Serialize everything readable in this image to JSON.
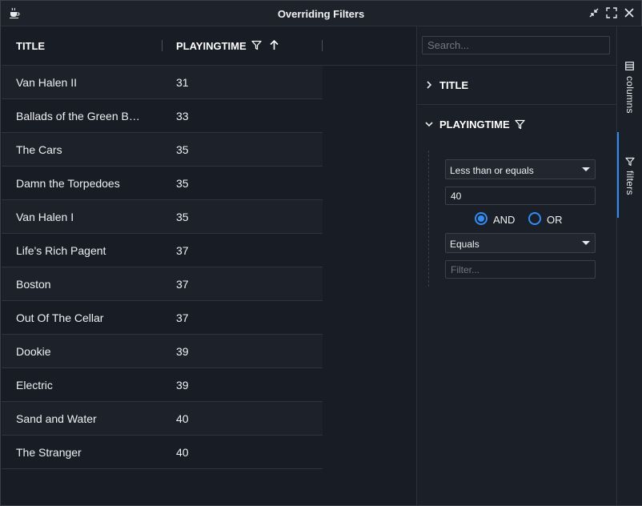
{
  "window": {
    "title": "Overriding Filters",
    "icon": "coffee-cup-icon",
    "controls": [
      "collapse-icon",
      "maximize-icon",
      "close-icon"
    ]
  },
  "grid": {
    "columns": [
      {
        "label": "TITLE"
      },
      {
        "label": "PLAYINGTIME",
        "icons": [
          "filter-icon",
          "sort-ascending-icon"
        ]
      }
    ],
    "rows": [
      {
        "title": "Van Halen II",
        "playingtime": "31"
      },
      {
        "title": "Ballads of the Green Ber...",
        "playingtime": "33"
      },
      {
        "title": "The Cars",
        "playingtime": "35"
      },
      {
        "title": "Damn the Torpedoes",
        "playingtime": "35"
      },
      {
        "title": "Van Halen I",
        "playingtime": "35"
      },
      {
        "title": "Life's Rich Pagent",
        "playingtime": "37"
      },
      {
        "title": "Boston",
        "playingtime": "37"
      },
      {
        "title": "Out Of The Cellar",
        "playingtime": "37"
      },
      {
        "title": "Dookie",
        "playingtime": "39"
      },
      {
        "title": "Electric",
        "playingtime": "39"
      },
      {
        "title": "Sand and Water",
        "playingtime": "40"
      },
      {
        "title": "The Stranger",
        "playingtime": "40"
      }
    ]
  },
  "filter_panel": {
    "search_placeholder": "Search...",
    "sections": [
      {
        "label": "TITLE",
        "expanded": false
      },
      {
        "label": "PLAYINGTIME",
        "expanded": true,
        "filtered": true
      }
    ],
    "condition1": {
      "operator": "Less than or equals",
      "value": "40"
    },
    "join": {
      "options": [
        "AND",
        "OR"
      ],
      "selected": "AND"
    },
    "condition2": {
      "operator": "Equals",
      "placeholder": "Filter..."
    }
  },
  "sidebar": {
    "tabs": [
      {
        "label": "columns",
        "icon": "columns-icon",
        "active": false
      },
      {
        "label": "filters",
        "icon": "filter-icon",
        "active": true
      }
    ]
  },
  "colors": {
    "accent": "#2f8ef3",
    "background": "#181c24"
  }
}
